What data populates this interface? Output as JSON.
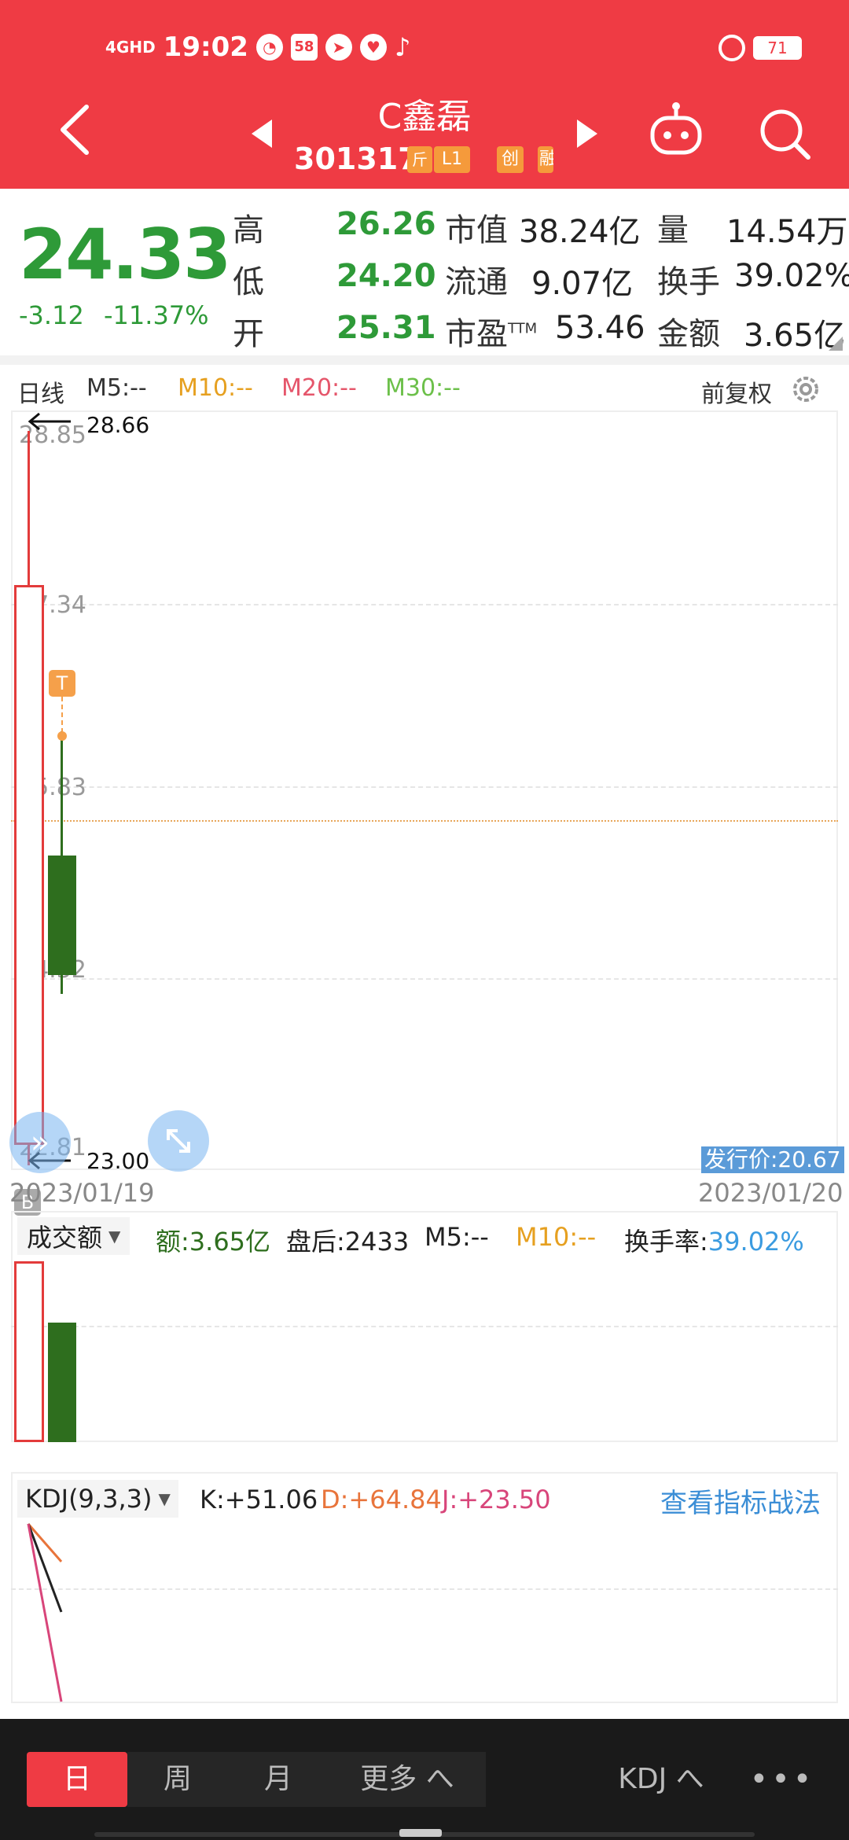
{
  "status_bar": {
    "network": "4GHD",
    "time": "19:02",
    "badge_58": "58",
    "battery": "71"
  },
  "header": {
    "stock_name": "C鑫磊",
    "stock_code": "301317",
    "tags": [
      "斤",
      "L1",
      "创",
      "融"
    ]
  },
  "quote": {
    "price": "24.33",
    "change": "-3.12",
    "change_pct": "-11.37%",
    "high_label": "高",
    "high": "26.26",
    "low_label": "低",
    "low": "24.20",
    "open_label": "开",
    "open": "25.31",
    "mcap_label": "市值",
    "mcap": "38.24亿",
    "float_label": "流通",
    "float": "9.07亿",
    "pe_label": "市盈",
    "pe_sup": "TTM",
    "pe": "53.46",
    "vol_label": "量",
    "vol": "14.54万",
    "turnover_label": "换手",
    "turnover": "39.02%",
    "amount_label": "金额",
    "amount": "3.65亿"
  },
  "kline": {
    "period": "日线",
    "ma5": "M5:--",
    "ma10": "M10:--",
    "ma20": "M20:--",
    "ma30": "M30:--",
    "adjust": "前复权",
    "price_levels": [
      "28.85",
      "27.34",
      "25.83",
      "24.32",
      "22.81"
    ],
    "max_mark": "28.66",
    "min_mark": "23.00",
    "t_marker": "T",
    "b_marker": "B",
    "issue_price": "发行价:20.67",
    "date_start": "2023/01/19",
    "date_end": "2023/01/20",
    "colors": {
      "up": "#e33b3b",
      "down": "#2e6e1e",
      "ma10": "#e6a020",
      "ma20": "#e5566b",
      "ma30": "#6cc04a"
    }
  },
  "volume": {
    "selector": "成交额",
    "amount": "额:3.65亿",
    "after_hours": "盘后:2433",
    "ma5": "M5:--",
    "ma10": "M10:--",
    "turnover_label": "换手率:",
    "turnover": "39.02%"
  },
  "kdj": {
    "selector": "KDJ(9,3,3)",
    "k": "K:+51.06",
    "d": "D:+64.84",
    "j": "J:+23.50",
    "link": "查看指标战法"
  },
  "bottom": {
    "tabs": [
      "日",
      "周",
      "月",
      "更多 へ"
    ],
    "indicator": "KDJ へ",
    "more": "•••"
  }
}
